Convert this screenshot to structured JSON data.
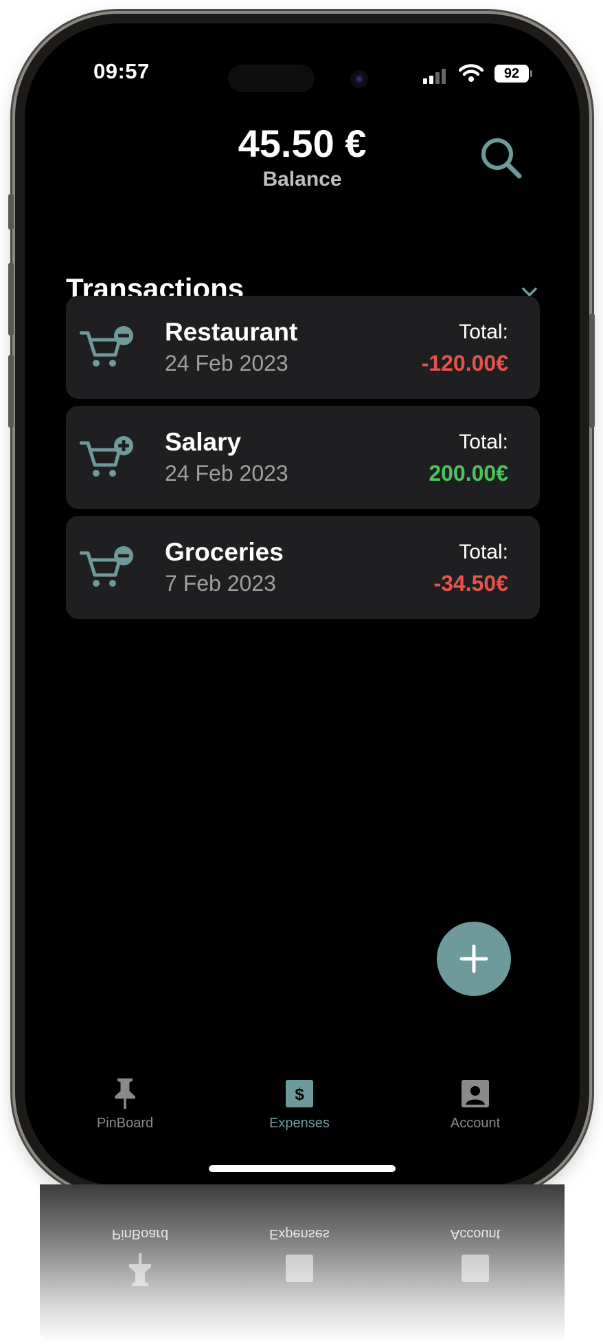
{
  "status_bar": {
    "time": "09:57",
    "battery": "92"
  },
  "header": {
    "balance": "45.50 €",
    "balance_label": "Balance"
  },
  "section": {
    "title": "Transactions"
  },
  "transactions": [
    {
      "title": "Restaurant",
      "date": "24 Feb 2023",
      "total_label": "Total:",
      "amount": "-120.00€",
      "kind": "expense"
    },
    {
      "title": "Salary",
      "date": "24 Feb 2023",
      "total_label": "Total:",
      "amount": "200.00€",
      "kind": "income"
    },
    {
      "title": "Groceries",
      "date": "7 Feb 2023",
      "total_label": "Total:",
      "amount": "-34.50€",
      "kind": "expense"
    }
  ],
  "tab_bar": {
    "items": [
      {
        "label": "PinBoard",
        "icon": "pin-icon",
        "active": false
      },
      {
        "label": "Expenses",
        "icon": "dollar-icon",
        "active": true
      },
      {
        "label": "Account",
        "icon": "account-icon",
        "active": false
      }
    ]
  },
  "colors": {
    "accent": "#6f9a9c",
    "negative": "#e5534b",
    "positive": "#4cc45c",
    "card": "#1f1f21"
  }
}
